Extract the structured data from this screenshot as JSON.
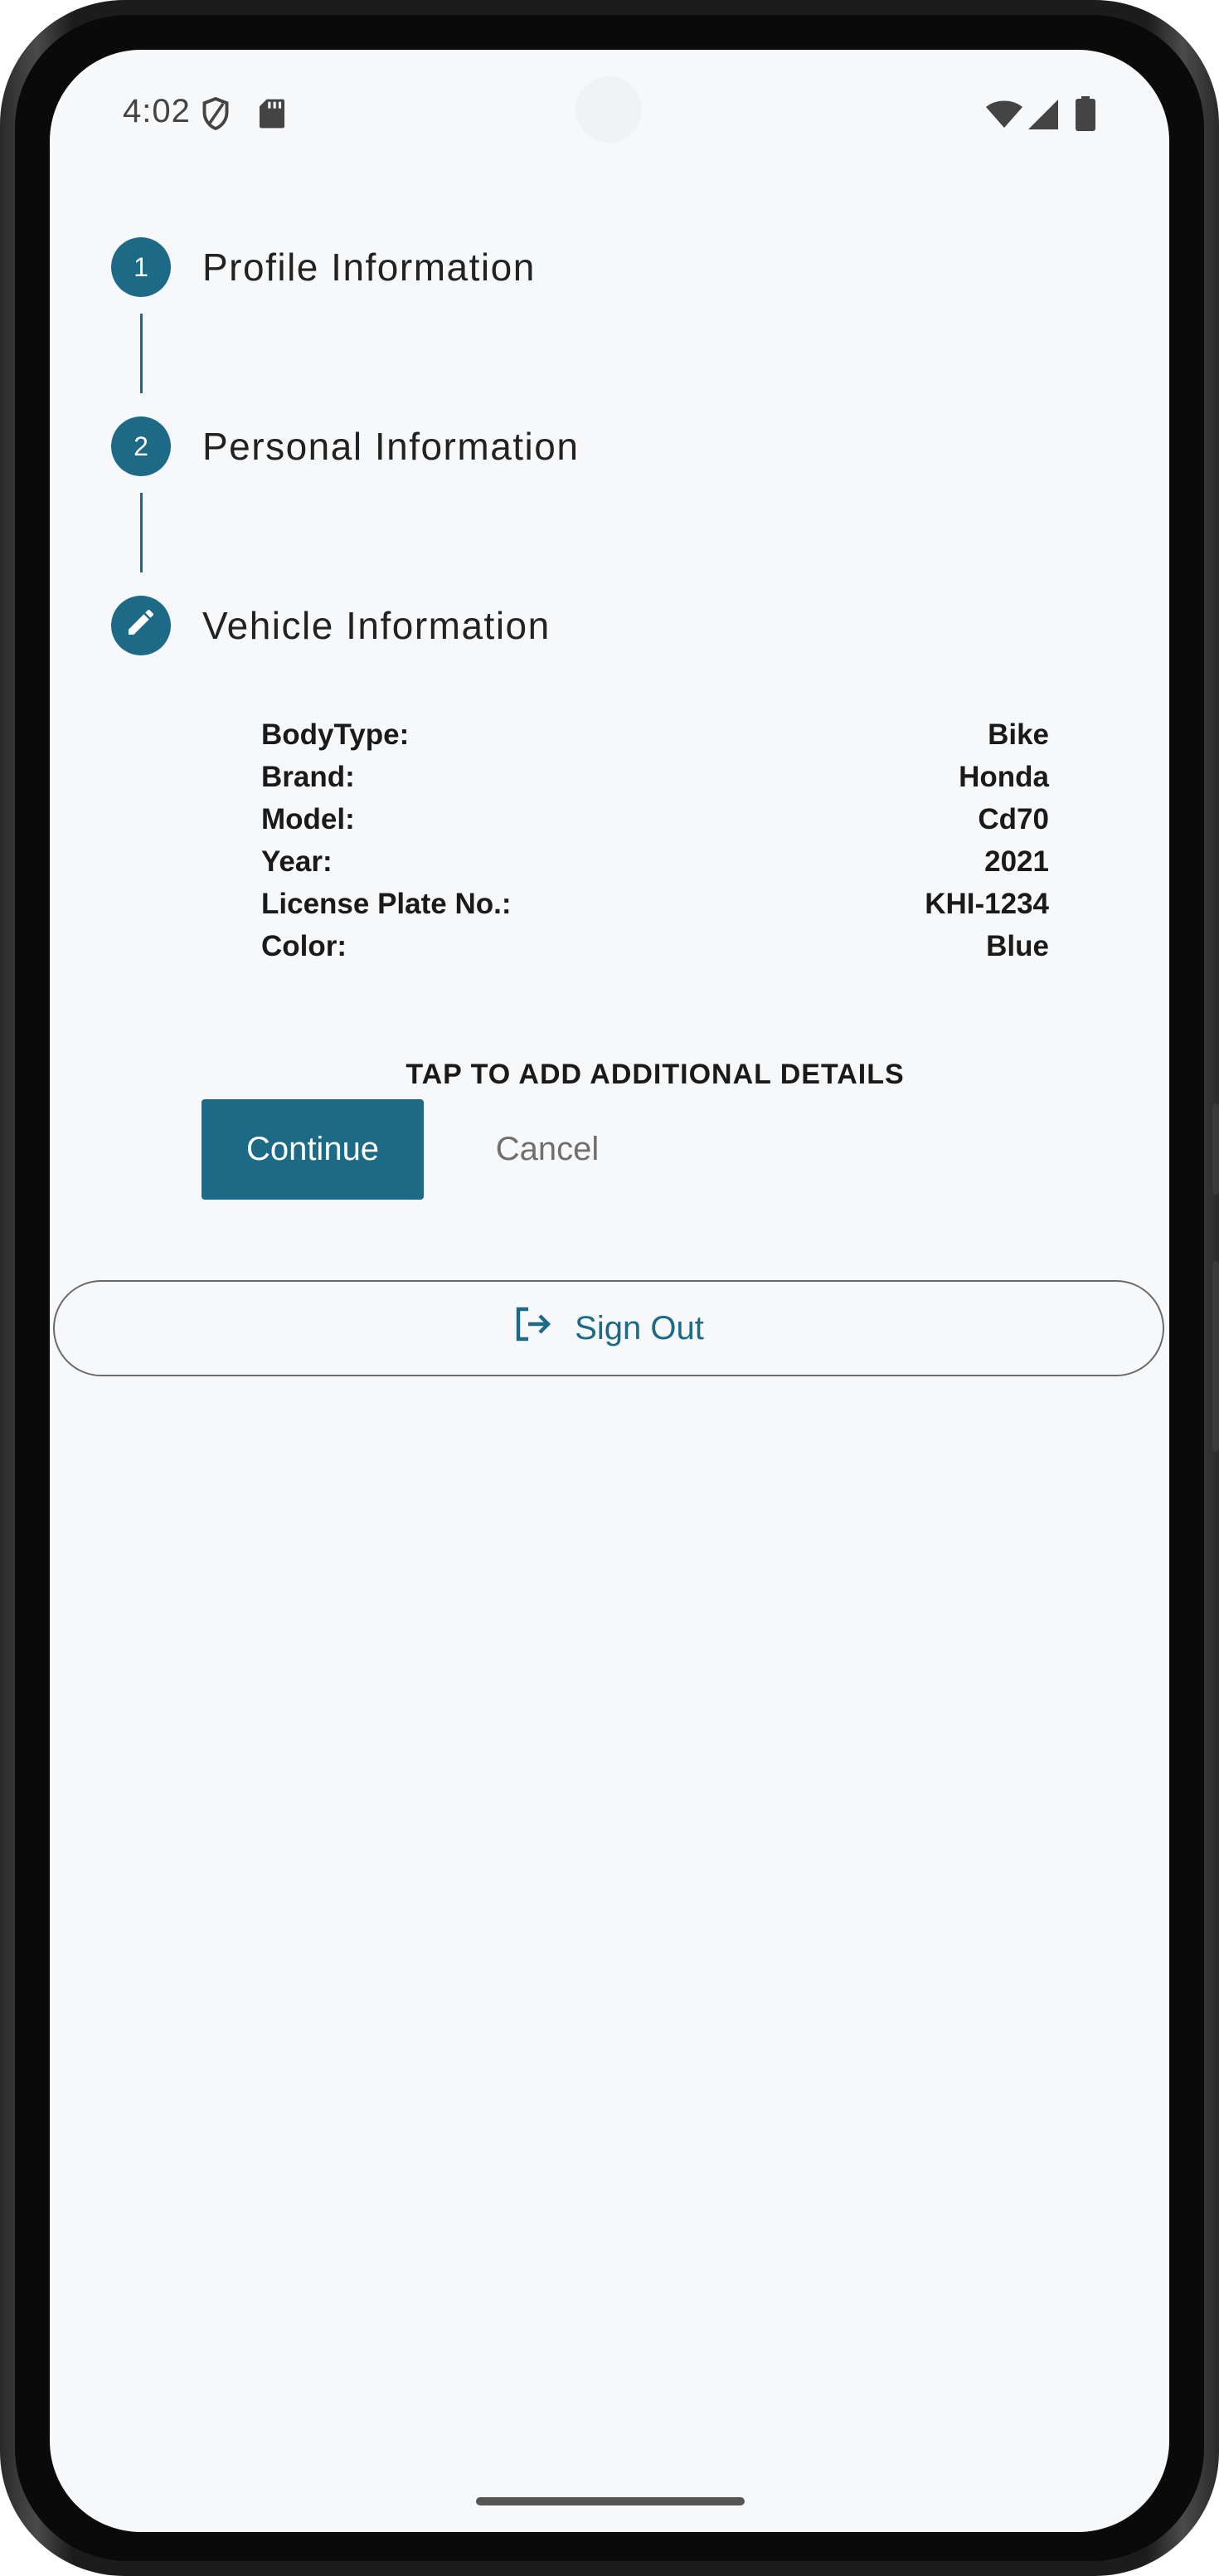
{
  "status_bar": {
    "time": "4:02",
    "left_icons": [
      "shield-icon",
      "sd-card-icon"
    ],
    "right_icons": [
      "wifi-icon",
      "signal-icon",
      "battery-icon"
    ]
  },
  "stepper": {
    "steps": [
      {
        "number": "1",
        "title": "Profile Information",
        "state": "complete"
      },
      {
        "number": "2",
        "title": "Personal Information",
        "state": "complete"
      },
      {
        "number": "",
        "title": "Vehicle Information",
        "state": "editing",
        "icon": "pencil-icon"
      }
    ]
  },
  "vehicle_details": [
    {
      "label": "BodyType:",
      "value": "Bike"
    },
    {
      "label": "Brand:",
      "value": "Honda"
    },
    {
      "label": "Model:",
      "value": "Cd70"
    },
    {
      "label": "Year:",
      "value": "2021"
    },
    {
      "label": "License Plate No.:",
      "value": "KHI-1234"
    },
    {
      "label": "Color:",
      "value": "Blue"
    }
  ],
  "tap_hint": "TAP TO ADD ADDITIONAL DETAILS",
  "actions": {
    "continue_label": "Continue",
    "cancel_label": "Cancel"
  },
  "sign_out": {
    "label": "Sign Out",
    "icon": "logout-icon"
  },
  "colors": {
    "accent": "#1c6a86",
    "background": "#f7f8fa",
    "muted_text": "#6f6f6f"
  }
}
